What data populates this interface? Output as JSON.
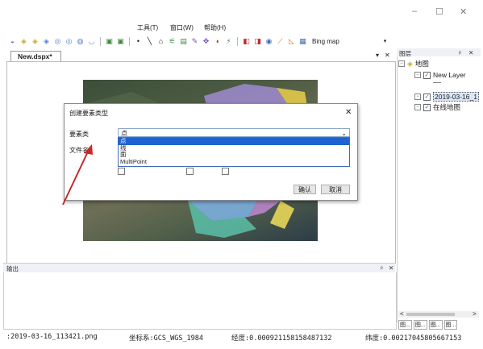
{
  "window": {
    "minimize": "–",
    "maximize": "☐",
    "close": "✕"
  },
  "menu": {
    "tools": "工具(T)",
    "window": "窗口(W)",
    "help": "帮助(H)"
  },
  "toolbar": {
    "basemap_label": "Bing map",
    "dropdown_arrow": "▾"
  },
  "document": {
    "tab_label": "New.dspx*",
    "pin": "▾",
    "close": "✕"
  },
  "dialog": {
    "title": "创建要素类型",
    "close": "✕",
    "feature_type_label": "要素类",
    "feature_type_value": "点",
    "file_name_label": "文件名",
    "options": [
      "点",
      "线",
      "面",
      "MultiPoint"
    ],
    "ok": "确认",
    "cancel": "取消"
  },
  "output_panel": {
    "title": "输出",
    "pin": "ᵖ",
    "close": "✕"
  },
  "layers_panel": {
    "title": "图层",
    "pin": "ᵖ",
    "close": "✕",
    "root": "地图",
    "items": [
      "New Layer",
      "2019-03-16_1",
      "在线地图"
    ],
    "scroll_left": "<",
    "scroll_right": ">",
    "bottom_tabs": [
      "图...",
      "图...",
      "图...",
      "图..."
    ]
  },
  "status": {
    "file": ":2019-03-16_113421.png",
    "crs": "坐标系:GCS_WGS_1984",
    "lon": "经度:0.000921158158487132",
    "lat": "纬度:0.0021704580566715З"
  },
  "colors": {
    "arrow": "#c42a2a",
    "selection": "#1e63d1",
    "panel_header": "#eef1f6"
  }
}
